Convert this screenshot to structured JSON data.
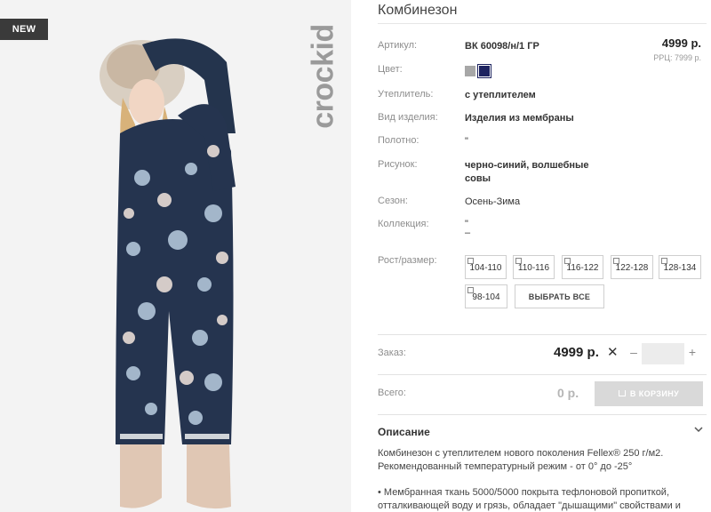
{
  "badge": "NEW",
  "brand": "crockid",
  "product": {
    "title": "Комбинезон",
    "price": "4999 р.",
    "rrp": "РРЦ: 7999 р."
  },
  "specs": {
    "article_label": "Артикул:",
    "article_value": "ВК 60098/н/1 ГР",
    "color_label": "Цвет:",
    "colors": [
      "#a7a7a7",
      "#1e2460"
    ],
    "insulation_label": "Утеплитель:",
    "insulation_value": "с утеплителем",
    "type_label": "Вид изделия:",
    "type_value": "Изделия из мембраны",
    "fabric_label": "Полотно:",
    "fabric_value": "\"",
    "pattern_label": "Рисунок:",
    "pattern_value_line1": "черно-синий, волшебные",
    "pattern_value_line2": "совы",
    "season_label": "Сезон:",
    "season_value": "Осень-Зима",
    "collection_label": "Коллекция:",
    "collection_value_line1": "\"",
    "collection_value_line2": "–"
  },
  "sizes": {
    "label": "Рост/размер:",
    "options": [
      "104-110",
      "110-116",
      "116-122",
      "122-128",
      "128-134",
      "98-104"
    ],
    "select_all": "ВЫБРАТЬ ВСЕ"
  },
  "order": {
    "label": "Заказ:",
    "price": "4999 р.",
    "times": "✕",
    "minus": "–",
    "quantity": "",
    "plus": "+"
  },
  "total": {
    "label": "Всего:",
    "value": "0 р.",
    "cart_button": "В КОРЗИНУ"
  },
  "description": {
    "heading": "Описание",
    "toggle_icon": "chevron-down-icon",
    "p1_line1": "Комбинезон с утеплителем нового поколения Fellex® 250 г/м2.",
    "p1_line2": "Рекомендованный температурный режим - от 0° до -25°",
    "p2_line1": "• Мембранная ткань 5000/5000 покрыта тефлоновой пропиткой,",
    "p2_line2": "отталкивающей воду и грязь, обладает \"дышащими\" свойствами и"
  }
}
